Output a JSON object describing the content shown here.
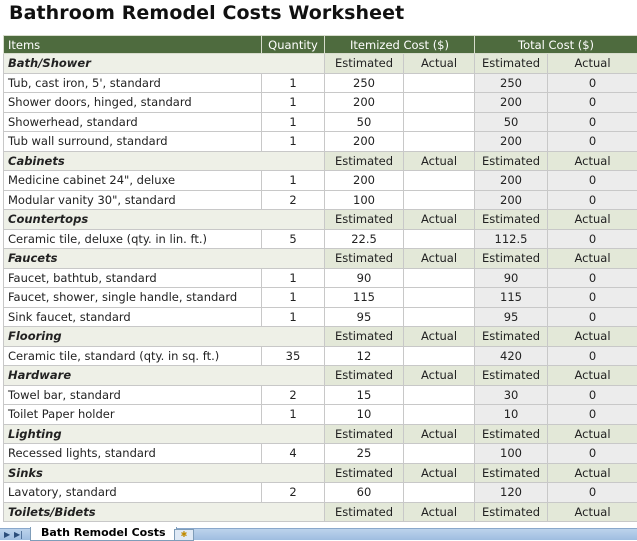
{
  "title": "Bathroom Remodel Costs Worksheet",
  "headers": {
    "items": "Items",
    "quantity": "Quantity",
    "itemized": "Itemized Cost ($)",
    "total": "Total Cost ($)"
  },
  "sub_labels": {
    "estimated": "Estimated",
    "actual": "Actual"
  },
  "categories": [
    {
      "name": "Bath/Shower",
      "items": [
        {
          "item": "Tub, cast iron, 5', standard",
          "qty": "1",
          "est": "250",
          "act": "",
          "tot_est": "250",
          "tot_act": "0"
        },
        {
          "item": "Shower doors, hinged, standard",
          "qty": "1",
          "est": "200",
          "act": "",
          "tot_est": "200",
          "tot_act": "0"
        },
        {
          "item": "Showerhead, standard",
          "qty": "1",
          "est": "50",
          "act": "",
          "tot_est": "50",
          "tot_act": "0"
        },
        {
          "item": "Tub wall surround, standard",
          "qty": "1",
          "est": "200",
          "act": "",
          "tot_est": "200",
          "tot_act": "0"
        }
      ]
    },
    {
      "name": "Cabinets",
      "items": [
        {
          "item": "Medicine cabinet 24\", deluxe",
          "qty": "1",
          "est": "200",
          "act": "",
          "tot_est": "200",
          "tot_act": "0"
        },
        {
          "item": "Modular vanity 30\", standard",
          "qty": "2",
          "est": "100",
          "act": "",
          "tot_est": "200",
          "tot_act": "0"
        }
      ]
    },
    {
      "name": "Countertops",
      "items": [
        {
          "item": "Ceramic tile, deluxe (qty. in lin. ft.)",
          "qty": "5",
          "est": "22.5",
          "act": "",
          "tot_est": "112.5",
          "tot_act": "0"
        }
      ]
    },
    {
      "name": "Faucets",
      "items": [
        {
          "item": "Faucet, bathtub, standard",
          "qty": "1",
          "est": "90",
          "act": "",
          "tot_est": "90",
          "tot_act": "0"
        },
        {
          "item": "Faucet, shower, single handle, standard",
          "qty": "1",
          "est": "115",
          "act": "",
          "tot_est": "115",
          "tot_act": "0"
        },
        {
          "item": "Sink faucet, standard",
          "qty": "1",
          "est": "95",
          "act": "",
          "tot_est": "95",
          "tot_act": "0"
        }
      ]
    },
    {
      "name": "Flooring",
      "items": [
        {
          "item": "Ceramic tile, standard (qty. in sq. ft.)",
          "qty": "35",
          "est": "12",
          "act": "",
          "tot_est": "420",
          "tot_act": "0"
        }
      ]
    },
    {
      "name": "Hardware",
      "items": [
        {
          "item": "Towel bar, standard",
          "qty": "2",
          "est": "15",
          "act": "",
          "tot_est": "30",
          "tot_act": "0"
        },
        {
          "item": "Toilet Paper holder",
          "qty": "1",
          "est": "10",
          "act": "",
          "tot_est": "10",
          "tot_act": "0"
        }
      ]
    },
    {
      "name": "Lighting",
      "items": [
        {
          "item": "Recessed lights, standard",
          "qty": "4",
          "est": "25",
          "act": "",
          "tot_est": "100",
          "tot_act": "0"
        }
      ]
    },
    {
      "name": "Sinks",
      "items": [
        {
          "item": "Lavatory, standard",
          "qty": "2",
          "est": "60",
          "act": "",
          "tot_est": "120",
          "tot_act": "0"
        }
      ]
    },
    {
      "name": "Toilets/Bidets",
      "items": []
    }
  ],
  "sheet_tabs": {
    "active": "Bath Remodel Costs",
    "new_tab_icon": "insert-sheet-icon"
  }
}
